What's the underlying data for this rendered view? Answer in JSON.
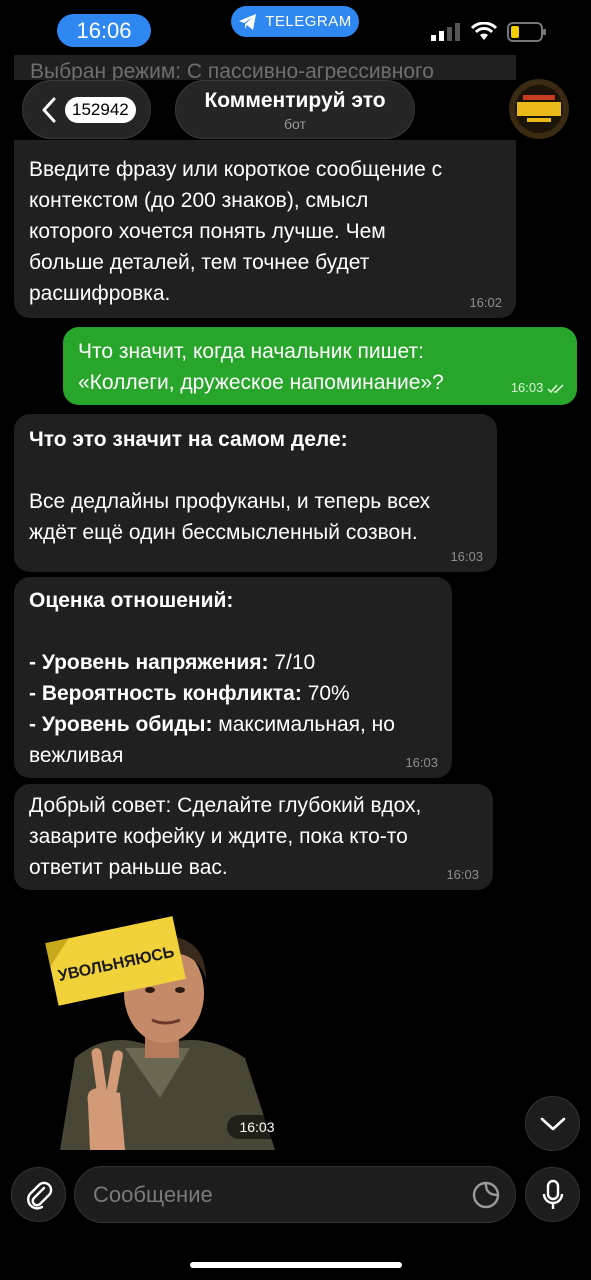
{
  "status_bar": {
    "time": "16:06",
    "app_pill": "TELEGRAM"
  },
  "header": {
    "unread_count": "152942",
    "chat_title": "Комментируй это",
    "chat_subtitle": "бот",
    "avatar_icon": "bot-avatar-icon"
  },
  "messages": {
    "partial_top": "Выбран режим: С пассивно-агрессивного",
    "m1": {
      "lines": [
        "Введите фразу или короткое сообщение с",
        "контекстом (до 200 знаков), смысл",
        "которого хочется понять лучше. Чем",
        "больше деталей, тем точнее будет",
        "расшифровка."
      ],
      "time": "16:02"
    },
    "m2": {
      "lines": [
        "Что значит, когда начальник пишет:",
        "«Коллеги, дружеское напоминание»?"
      ],
      "time": "16:03"
    },
    "m3": {
      "heading": "Что это значит на самом деле:",
      "lines": [
        "Все дедлайны профуканы, и теперь всех",
        "ждёт ещё один бессмысленный созвон."
      ],
      "time": "16:03"
    },
    "m4": {
      "heading": "Оценка отношений:",
      "r1_label": "- Уровень напряжения:",
      "r1_value": " 7/10",
      "r2_label": "- Вероятность конфликта:",
      "r2_value": " 70%",
      "r3_label": "- Уровень обиды:",
      "r3_value": " максимальная, но",
      "r3_cont": "вежливая",
      "time": "16:03"
    },
    "m5": {
      "lines": [
        "Добрый совет: Сделайте глубокий вдох,",
        "заварите кофейку и ждите, пока кто-то",
        "ответит раньше вас."
      ],
      "time": "16:03"
    },
    "sticker": {
      "note_text": "УВОЛЬНЯЮСЬ",
      "time": "16:03"
    }
  },
  "composer": {
    "placeholder": "Сообщение"
  },
  "colors": {
    "accent": "#2f87f2",
    "outgoing": "#28a52b",
    "incoming": "#202021"
  }
}
